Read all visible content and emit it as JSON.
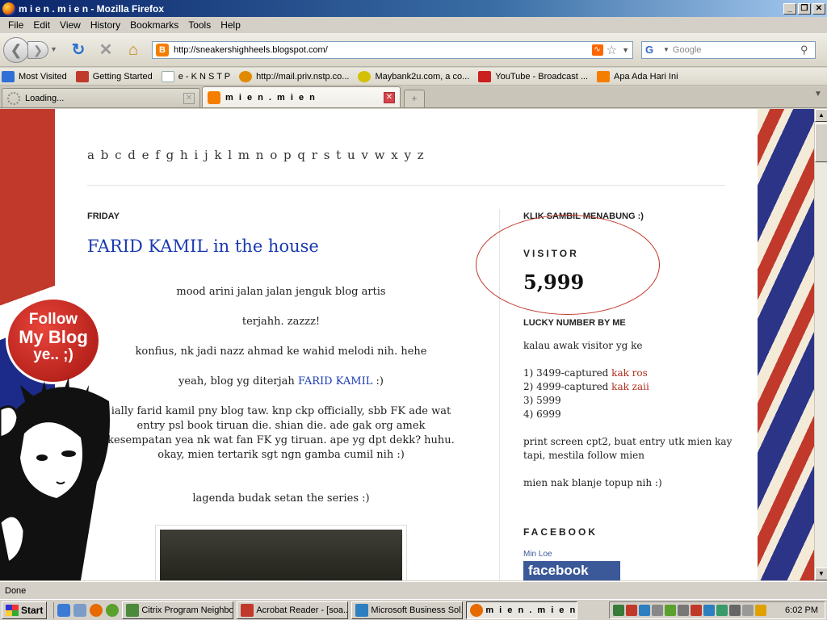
{
  "window": {
    "title": "m i e n . m i e n - Mozilla Firefox",
    "buttons": [
      "_",
      "❐",
      "✕"
    ]
  },
  "menu": [
    "File",
    "Edit",
    "View",
    "History",
    "Bookmarks",
    "Tools",
    "Help"
  ],
  "nav": {
    "url": "http://sneakershighheels.blogspot.com/",
    "search_placeholder": "Google"
  },
  "bookmarks": [
    {
      "label": "Most Visited",
      "icon": "bookmark-folder-icon",
      "color": "#2f6fd6"
    },
    {
      "label": "Getting Started",
      "icon": "firefox-getting-started-icon",
      "color": "#c0392b"
    },
    {
      "label": "e - K N S T P",
      "icon": "page-icon",
      "color": "#9aa"
    },
    {
      "label": "http://mail.priv.nstp.co...",
      "icon": "mail-icon",
      "color": "#e08a00"
    },
    {
      "label": "Maybank2u.com, a co...",
      "icon": "maybank-icon",
      "color": "#d4c000"
    },
    {
      "label": "YouTube - Broadcast ...",
      "icon": "youtube-icon",
      "color": "#cc1f1f"
    },
    {
      "label": "Apa Ada Hari Ini",
      "icon": "blogger-icon",
      "color": "#f57d00"
    }
  ],
  "tabs": [
    {
      "label": "Loading...",
      "active": false
    },
    {
      "label": "m i e n . m i e n",
      "active": true
    }
  ],
  "page": {
    "alphabet": "a b c d e f g h i j k l m n o p q r s t u v w x y z",
    "date": "FRIDAY",
    "post_title": "FARID KAMIL in the house",
    "paragraphs": {
      "p1": "mood arini jalan jalan jenguk blog artis",
      "p2": "terjahh. zazzz!",
      "p3": "konfius, nk jadi nazz ahmad ke wahid melodi nih. hehe",
      "p4_pre": "yeah, blog yg diterjah ",
      "p4_link": "FARID KAMIL",
      "p4_post": " :)",
      "p5": "ially farid kamil pny blog taw. knp ckp officially, sbb FK ade wat entry psl book tiruan die. shian die. ade gak org amek kesempatan yea nk wat fan FK yg tiruan. ape yg dpt dekk? huhu. okay, mien tertarik sgt ngn gamba cumil nih :)",
      "p6": "lagenda budak setan the series :)"
    }
  },
  "sidebar": {
    "klik": "KLIK SAMBIL MENABUNG :)",
    "visitor_label": "VISITOR",
    "visitor_count": "5,999",
    "lucky_title": "LUCKY NUMBER BY ME",
    "lucky_intro": "kalau awak visitor yg ke",
    "lucky_items": [
      {
        "text": "1) 3499-captured ",
        "link": "kak ros"
      },
      {
        "text": "2) 4999-captured ",
        "link": "kak zaii"
      },
      {
        "text": "3) 5999",
        "link": ""
      },
      {
        "text": "4) 6999",
        "link": ""
      }
    ],
    "lucky_note": "print screen cpt2, buat entry utk mien kay tapi, mestila follow mien",
    "lucky_end": "mien nak blanje topup nih :)",
    "facebook_title": "FACEBOOK",
    "facebook_name": "Min Loe",
    "facebook_badge": "facebook"
  },
  "follow_badge": {
    "l1": "Follow",
    "l2": "My Blog",
    "l3": "ye.. ;)"
  },
  "status": "Done",
  "taskbar": {
    "start": "Start",
    "tasks": [
      {
        "label": "Citrix Program Neighbo...",
        "color": "#4a8a3a"
      },
      {
        "label": "Acrobat Reader - [soa...",
        "color": "#c0392b"
      },
      {
        "label": "Microsoft Business Sol...",
        "color": "#2e7fc0"
      },
      {
        "label": "m i e n . m i e n - ...",
        "color": "#e66a00"
      }
    ],
    "clock": "6:02 PM"
  }
}
